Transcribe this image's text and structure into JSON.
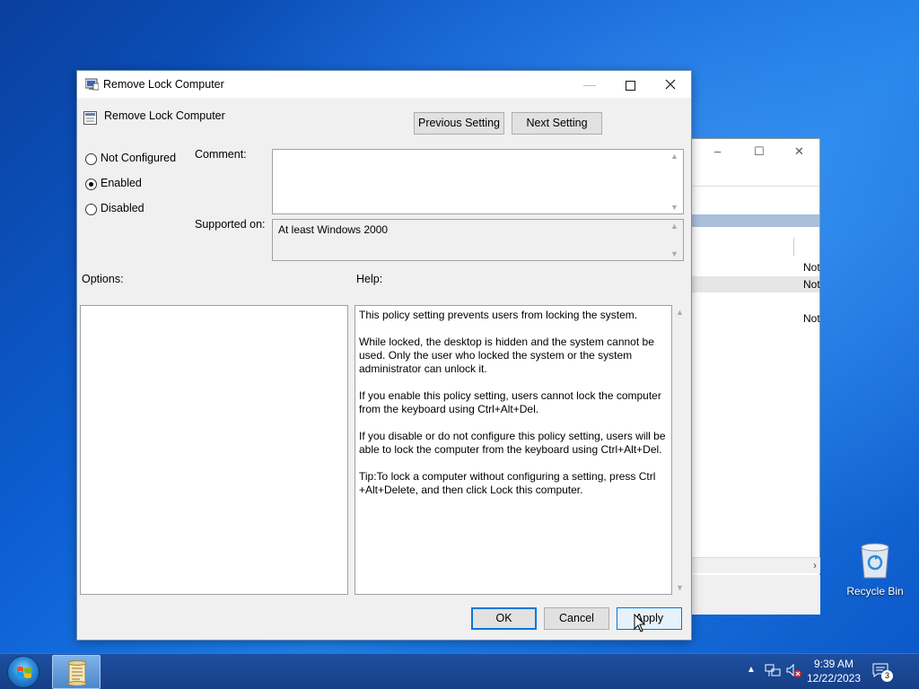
{
  "dialog": {
    "title": "Remove Lock Computer",
    "policy_name": "Remove Lock Computer",
    "previous_setting": "Previous Setting",
    "next_setting": "Next Setting",
    "state_options": {
      "not_configured": "Not Configured",
      "enabled": "Enabled",
      "disabled": "Disabled",
      "selected": "enabled"
    },
    "comment_label": "Comment:",
    "comment_value": "",
    "supported_on_label": "Supported on:",
    "supported_on_value": "At least Windows 2000",
    "options_label": "Options:",
    "help_label": "Help:",
    "help_paragraphs": [
      "This policy setting prevents users from locking the system.",
      "While locked, the desktop is hidden and the system cannot be used. Only the user who locked the system or the system administrator can unlock it.",
      "If you enable this policy setting, users cannot lock the computer from the keyboard using Ctrl+Alt+Del.",
      "If you disable or do not configure this policy setting, users will be able to lock the computer from the keyboard using Ctrl+Alt+Del.",
      "Tip:To lock a computer without configuring a setting, press Ctrl +Alt+Delete, and then click Lock this computer."
    ],
    "ok": "OK",
    "cancel": "Cancel",
    "apply": "Apply"
  },
  "background_window": {
    "column_values": [
      "Not",
      "Not",
      "Not"
    ]
  },
  "desktop": {
    "recycle_bin": "Recycle Bin"
  },
  "taskbar": {
    "time": "9:39 AM",
    "date": "12/22/2023",
    "notification_count": "3"
  }
}
